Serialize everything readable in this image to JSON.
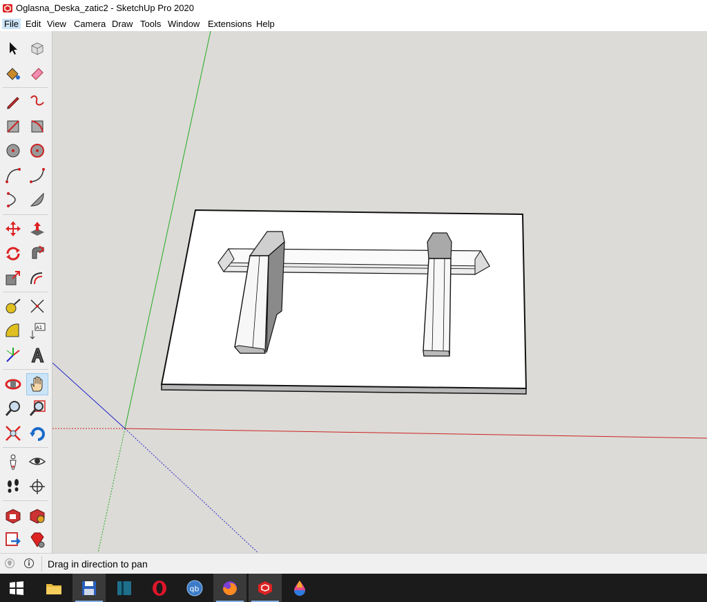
{
  "window": {
    "title": "Oglasna_Deska_zatic2 - SketchUp Pro 2020"
  },
  "menu": {
    "items": [
      "File",
      "Edit",
      "View",
      "Camera",
      "Draw",
      "Tools",
      "Window",
      "Extensions",
      "Help"
    ]
  },
  "toolbar": {
    "selected_tool": "pan"
  },
  "status": {
    "message": "Drag in direction to pan"
  },
  "taskbar": {
    "apps": [
      "start-icon",
      "file-explorer-icon",
      "save-app-icon",
      "book-app-icon",
      "opera-icon",
      "qbittorrent-icon",
      "firefox-icon",
      "sketchup-icon",
      "paint-drop-icon"
    ],
    "qb_label": "qb"
  },
  "colors": {
    "viewport_bg": "#dcdbd7",
    "axis_red": "#cc2222",
    "axis_green": "#22aa22",
    "axis_blue": "#2222cc",
    "selection": "#cce4f7"
  }
}
